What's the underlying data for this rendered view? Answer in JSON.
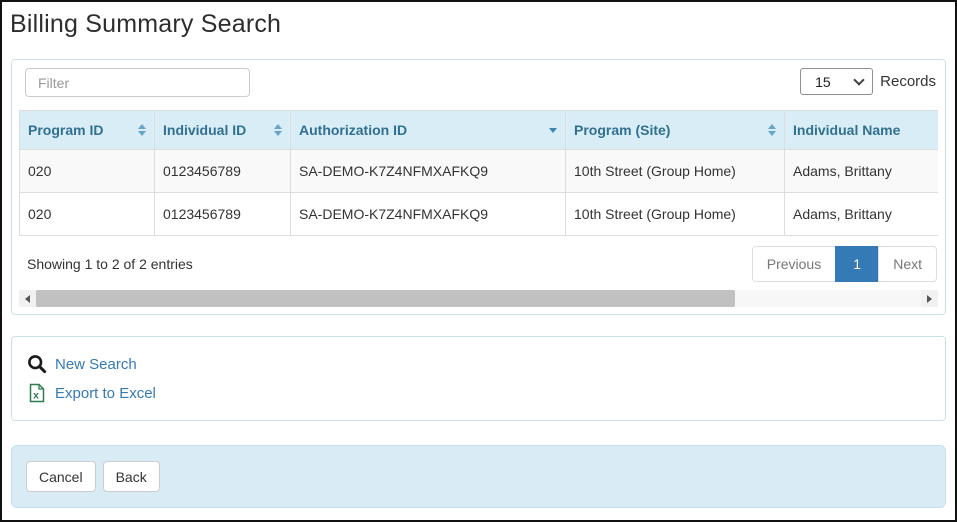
{
  "page": {
    "title": "Billing Summary Search"
  },
  "results_panel": {
    "filter": {
      "placeholder": "Filter"
    },
    "records": {
      "selected": "15",
      "label": "Records"
    },
    "table": {
      "columns": [
        {
          "label": "Program ID",
          "sort": "both"
        },
        {
          "label": "Individual ID",
          "sort": "both"
        },
        {
          "label": "Authorization ID",
          "sort": "desc"
        },
        {
          "label": "Program (Site)",
          "sort": "both"
        },
        {
          "label": "Individual Name",
          "sort": "none"
        }
      ],
      "rows": [
        [
          "020",
          "0123456789",
          "SA-DEMO-K7Z4NFMXAFKQ9",
          "10th Street (Group Home)",
          "Adams, Brittany"
        ],
        [
          "020",
          "0123456789",
          "SA-DEMO-K7Z4NFMXAFKQ9",
          "10th Street (Group Home)",
          "Adams, Brittany"
        ]
      ]
    },
    "info": "Showing 1 to 2 of 2 entries",
    "pagination": {
      "previous": "Previous",
      "page": "1",
      "next": "Next"
    }
  },
  "actions_panel": {
    "new_search_label": "New Search",
    "export_label": "Export to Excel"
  },
  "footer": {
    "cancel_label": "Cancel",
    "back_label": "Back"
  },
  "colors": {
    "link": "#337ab7",
    "table_header_bg": "#d9edf7",
    "table_header_text": "#31708f",
    "active_page_bg": "#337ab7",
    "footer_bg": "#d9ecf6",
    "panel_border": "#c9e2e8"
  }
}
